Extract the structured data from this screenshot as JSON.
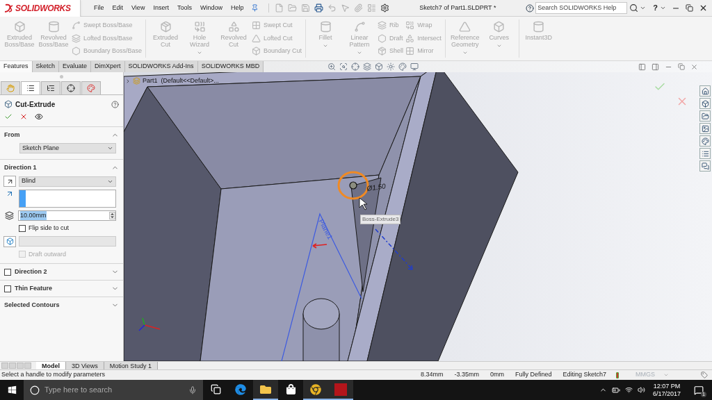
{
  "title_bar": {
    "logo": "SOLIDWORKS",
    "menu": [
      "File",
      "Edit",
      "View",
      "Insert",
      "Tools",
      "Window",
      "Help"
    ],
    "document_title": "Sketch7 of Part1.SLDPRT *",
    "search": {
      "placeholder": "Search SOLIDWORKS Help"
    },
    "help": "?"
  },
  "command_manager": [
    [
      {
        "kind": "large",
        "label": "Extruded Boss/Base",
        "disabled": true,
        "dropdown": false
      },
      {
        "kind": "large",
        "label": "Revolved Boss/Base",
        "disabled": true,
        "dropdown": false
      },
      {
        "kind": "stack",
        "items": [
          {
            "label": "Swept Boss/Base",
            "disabled": true
          },
          {
            "label": "Lofted Boss/Base",
            "disabled": true
          },
          {
            "label": "Boundary Boss/Base",
            "disabled": true
          }
        ]
      }
    ],
    [
      {
        "kind": "large",
        "label": "Extruded Cut",
        "disabled": true,
        "dropdown": false
      },
      {
        "kind": "large",
        "label": "Hole Wizard",
        "disabled": true,
        "dropdown": true
      },
      {
        "kind": "large",
        "label": "Revolved Cut",
        "disabled": true,
        "dropdown": false
      },
      {
        "kind": "stack",
        "items": [
          {
            "label": "Swept Cut",
            "disabled": true
          },
          {
            "label": "Lofted Cut",
            "disabled": true
          },
          {
            "label": "Boundary Cut",
            "disabled": true
          }
        ]
      }
    ],
    [
      {
        "kind": "large",
        "label": "Fillet",
        "disabled": true,
        "dropdown": true
      },
      {
        "kind": "large",
        "label": "Linear Pattern",
        "disabled": true,
        "dropdown": true
      },
      {
        "kind": "stack",
        "items": [
          {
            "label": "Rib",
            "disabled": true
          },
          {
            "label": "Draft",
            "disabled": true
          },
          {
            "label": "Shell",
            "disabled": true
          }
        ]
      },
      {
        "kind": "stack",
        "items": [
          {
            "label": "Wrap",
            "disabled": true
          },
          {
            "label": "Intersect",
            "disabled": true
          },
          {
            "label": "Mirror",
            "disabled": true
          }
        ]
      }
    ],
    [
      {
        "kind": "large",
        "label": "Reference Geometry",
        "disabled": true,
        "dropdown": true
      },
      {
        "kind": "large",
        "label": "Curves",
        "disabled": true,
        "dropdown": true
      }
    ],
    [
      {
        "kind": "large",
        "label": "Instant3D",
        "disabled": true,
        "dropdown": false
      }
    ]
  ],
  "tabs": [
    {
      "label": "Features",
      "selected": true
    },
    {
      "label": "Sketch",
      "selected": false
    },
    {
      "label": "Evaluate",
      "selected": false
    },
    {
      "label": "DimXpert",
      "selected": false
    },
    {
      "label": "SOLIDWORKS Add-Ins",
      "selected": false
    },
    {
      "label": "SOLIDWORKS MBD",
      "selected": false
    }
  ],
  "property_manager": {
    "tabs": [
      {
        "selected": false
      },
      {
        "selected": true
      },
      {
        "selected": false
      },
      {
        "selected": false
      },
      {
        "selected": false
      }
    ],
    "title": "Cut-Extrude",
    "sections": [
      {
        "kind": "from",
        "title": "From",
        "expanded": true,
        "field": "Sketch Plane"
      },
      {
        "kind": "direction",
        "title": "Direction 1",
        "expanded": true,
        "end_condition": "Blind",
        "depth": "10.00mm",
        "flip": {
          "label": "Flip side to cut",
          "checked": false
        },
        "draft": {
          "label": "Draft outward",
          "checked": false,
          "disabled": true
        }
      },
      {
        "kind": "toggle",
        "title": "Direction 2",
        "checked": false,
        "expanded": false
      },
      {
        "kind": "toggle",
        "title": "Thin Feature",
        "checked": false,
        "expanded": false
      },
      {
        "kind": "plain",
        "title": "Selected Contours",
        "expanded": false
      }
    ]
  },
  "viewport": {
    "tree_flyout": "Part1  (Default<<Default>...",
    "dimension": "Ø1.50",
    "plane_label": "Plane1",
    "tooltip": "Boss-Extrude3"
  },
  "bottom_tabs": [
    {
      "label": "Model",
      "selected": true
    },
    {
      "label": "3D Views",
      "selected": false
    },
    {
      "label": "Motion Study 1",
      "selected": false
    }
  ],
  "status_bar": {
    "message": "Select a handle to modify parameters",
    "fields": [
      "8.34mm",
      "-3.35mm",
      "0mm",
      "Fully Defined",
      "Editing Sketch7"
    ],
    "units": "MMGS"
  },
  "taskbar": {
    "search": {
      "placeholder": "Type here to search"
    },
    "apps": [
      {
        "running": false
      },
      {
        "running": false
      },
      {
        "running": true
      },
      {
        "running": false
      },
      {
        "running": true
      },
      {
        "running": true
      }
    ],
    "time": "12:07 PM",
    "date": "6/17/2017",
    "notifications": "1"
  }
}
